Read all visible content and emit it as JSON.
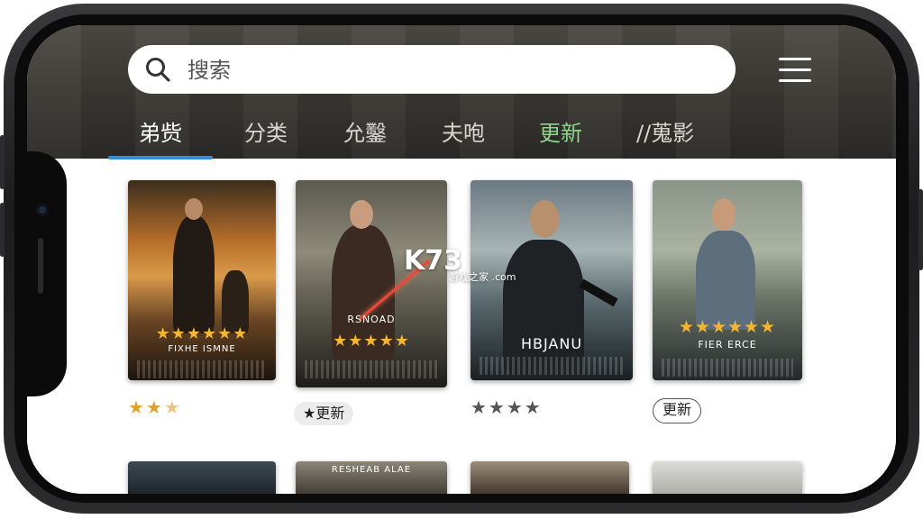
{
  "search": {
    "placeholder": "搜索"
  },
  "tabs": [
    {
      "label": "弟赀",
      "state": "active"
    },
    {
      "label": "分类",
      "state": "normal"
    },
    {
      "label": "允鑿",
      "state": "normal"
    },
    {
      "label": "夫咆",
      "state": "normal"
    },
    {
      "label": "更新",
      "state": "highlight"
    },
    {
      "label": "//蒐影",
      "state": "normal"
    }
  ],
  "colors": {
    "tab_underline": "#2e8ee0",
    "highlight_tab": "#8fd48a",
    "star": "#f2b632",
    "gray_star": "#555555"
  },
  "movies": [
    {
      "poster_title": "FIXHE ISMNE",
      "poster_rating": "★★★★★★",
      "rating": "★★",
      "rating_half": "★",
      "badge": ""
    },
    {
      "poster_title": "RSNOAD",
      "poster_rating": "★★★★★",
      "rating": "",
      "rating_half": "",
      "badge": "★更新"
    },
    {
      "poster_title": "HBJANU",
      "poster_rating": "",
      "rating": "★★★★",
      "rating_half": "",
      "badge": ""
    },
    {
      "poster_title": "FIER ERCE",
      "poster_rating": "★★★★★★",
      "rating": "",
      "rating_half": "",
      "badge": "更新"
    }
  ],
  "row2_titles": [
    "",
    "RESHEAB ALAE",
    "",
    ""
  ],
  "watermark": {
    "logo": "K73",
    "site": "游戏之家 .com"
  },
  "icons": {
    "search": "search-icon",
    "menu": "menu-icon"
  }
}
